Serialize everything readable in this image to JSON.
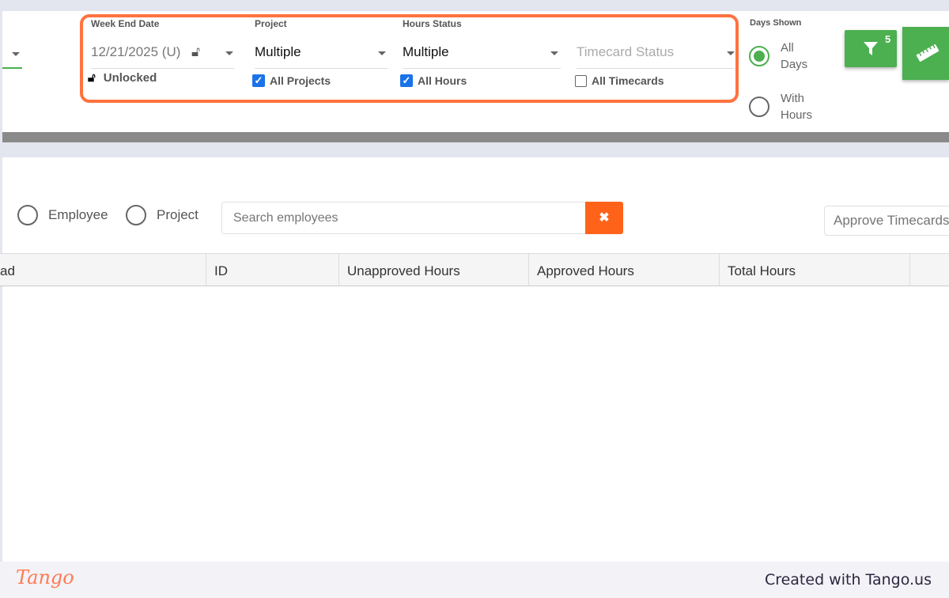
{
  "filters": {
    "week_end_date": {
      "label": "Week End Date",
      "value": "12/21/2025 (U)",
      "lock_status": "Unlocked"
    },
    "project": {
      "label": "Project",
      "value": "Multiple",
      "checkbox_label": "All Projects",
      "checked": true
    },
    "hours_status": {
      "label": "Hours Status",
      "value": "Multiple",
      "checkbox_label": "All Hours",
      "checked": true
    },
    "timecard_status": {
      "placeholder": "Timecard Status",
      "checkbox_label": "All Timecards",
      "checked": false
    },
    "days_shown": {
      "label": "Days Shown",
      "options": [
        "All Days",
        "With Hours"
      ],
      "selected": "All Days"
    },
    "filter_count": "5"
  },
  "toolbar": {
    "view_options": [
      "Employee",
      "Project"
    ],
    "search_placeholder": "Search employees",
    "approve_placeholder": "Approve Timecards"
  },
  "table": {
    "columns": [
      "ad",
      "ID",
      "Unapproved Hours",
      "Approved Hours",
      "Total Hours"
    ]
  },
  "footer": {
    "logo": "Tango",
    "credit": "Created with Tango.us"
  },
  "colors": {
    "accent_green": "#4caf50",
    "highlight": "#ff7340",
    "clear_button": "#ff6319"
  }
}
